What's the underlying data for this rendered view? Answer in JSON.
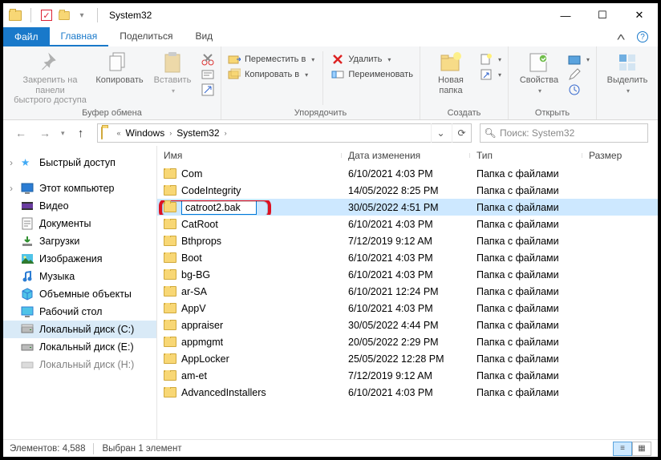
{
  "title": "System32",
  "tabs": {
    "file": "Файл",
    "home": "Главная",
    "share": "Поделиться",
    "view": "Вид"
  },
  "ribbon": {
    "pin": "Закрепить на панели\nбыстрого доступа",
    "copy": "Копировать",
    "paste": "Вставить",
    "group_clip": "Буфер обмена",
    "move": "Переместить в",
    "copyto": "Копировать в",
    "delete": "Удалить",
    "rename": "Переименовать",
    "group_org": "Упорядочить",
    "newfolder": "Новая\nпапка",
    "group_new": "Создать",
    "props": "Свойства",
    "group_open": "Открыть",
    "select": "Выделить",
    "drop": "▾"
  },
  "breadcrumb": {
    "pre": "«",
    "p1": "Windows",
    "p2": "System32"
  },
  "search_placeholder": "Поиск: System32",
  "sidebar": {
    "quick": "Быстрый доступ",
    "pc": "Этот компьютер",
    "video": "Видео",
    "docs": "Документы",
    "down": "Загрузки",
    "pics": "Изображения",
    "music": "Музыка",
    "obj": "Объемные объекты",
    "desk": "Рабочий стол",
    "cdisk": "Локальный диск (C:)",
    "edisk": "Локальный диск (E:)",
    "hdisk": "Локальный диск (H:)"
  },
  "columns": {
    "name": "Имя",
    "date": "Дата изменения",
    "type": "Тип",
    "size": "Размер"
  },
  "rename_value": "catroot2.bak",
  "type_folder": "Папка с файлами",
  "rows": [
    {
      "name": "Com",
      "date": "6/10/2021 4:03 PM"
    },
    {
      "name": "CodeIntegrity",
      "date": "14/05/2022 8:25 PM"
    },
    {
      "name": "_RENAME_",
      "date": "30/05/2022 4:51 PM"
    },
    {
      "name": "CatRoot",
      "date": "6/10/2021 4:03 PM"
    },
    {
      "name": "Bthprops",
      "date": "7/12/2019 9:12 AM"
    },
    {
      "name": "Boot",
      "date": "6/10/2021 4:03 PM"
    },
    {
      "name": "bg-BG",
      "date": "6/10/2021 4:03 PM"
    },
    {
      "name": "ar-SA",
      "date": "6/10/2021 12:24 PM"
    },
    {
      "name": "AppV",
      "date": "6/10/2021 4:03 PM"
    },
    {
      "name": "appraiser",
      "date": "30/05/2022 4:44 PM"
    },
    {
      "name": "appmgmt",
      "date": "20/05/2022 2:29 PM"
    },
    {
      "name": "AppLocker",
      "date": "25/05/2022 12:28 PM"
    },
    {
      "name": "am-et",
      "date": "7/12/2019 9:12 AM"
    },
    {
      "name": "AdvancedInstallers",
      "date": "6/10/2021 4:03 PM"
    }
  ],
  "status": {
    "items_label": "Элементов:",
    "items_count": "4,588",
    "sel": "Выбран 1 элемент"
  }
}
